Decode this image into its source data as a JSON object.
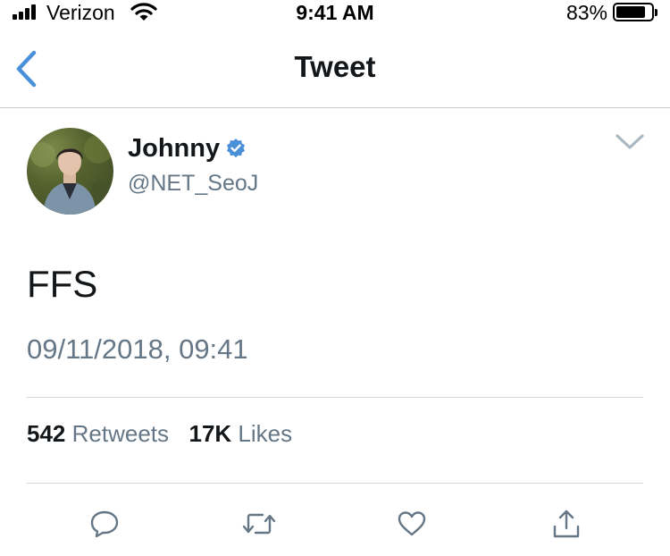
{
  "status_bar": {
    "carrier": "Verizon",
    "time": "9:41 AM",
    "battery_percent": "83%",
    "battery_level": 0.83,
    "signal_icon": "cellular-signal-icon",
    "wifi_icon": "wifi-icon",
    "battery_icon": "battery-icon"
  },
  "nav": {
    "title": "Tweet",
    "back_icon": "back-chevron-icon"
  },
  "tweet": {
    "author_name": "Johnny",
    "author_handle": "@NET_SeoJ",
    "verified": true,
    "text": "FFS",
    "timestamp": "09/11/2018, 09:41",
    "retweet_count": "542",
    "retweet_label": "Retweets",
    "like_count": "17K",
    "like_label": "Likes"
  },
  "actions": [
    {
      "icon": "reply-icon"
    },
    {
      "icon": "retweet-icon"
    },
    {
      "icon": "like-heart-icon"
    },
    {
      "icon": "share-icon"
    }
  ],
  "colors": {
    "accent": "#4a90d9",
    "primary_text": "#14171a",
    "secondary_text": "#657786",
    "icon": "#657786",
    "divider": "#d6d6d6"
  }
}
